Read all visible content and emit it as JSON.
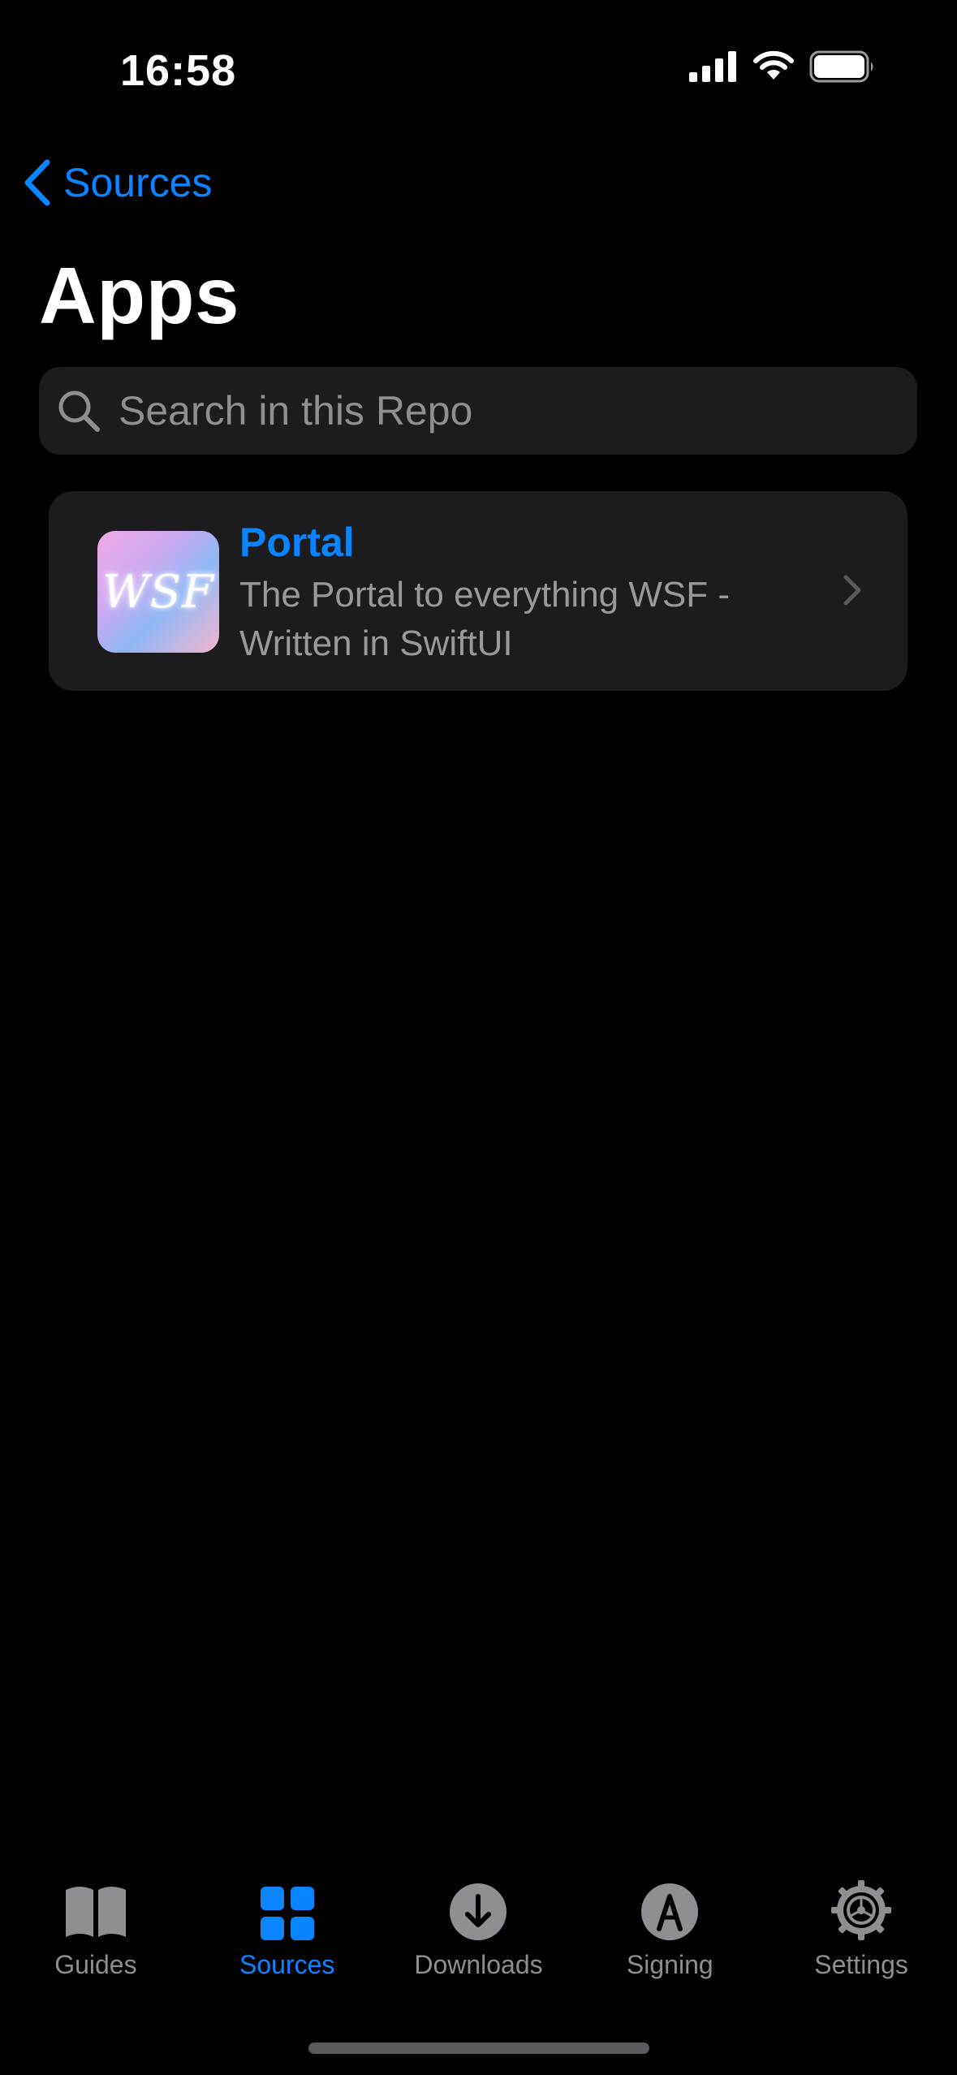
{
  "status_bar": {
    "time": "16:58"
  },
  "nav": {
    "back_label": "Sources",
    "title": "Apps"
  },
  "search": {
    "placeholder": "Search in this Repo",
    "value": ""
  },
  "apps": [
    {
      "icon_text": "WSF",
      "name": "Portal",
      "description": "The Portal to everything WSF - Written in SwiftUI"
    }
  ],
  "tabbar": {
    "active": "Sources",
    "items": [
      {
        "label": "Guides",
        "icon": "book-icon"
      },
      {
        "label": "Sources",
        "icon": "grid-icon"
      },
      {
        "label": "Downloads",
        "icon": "download-icon"
      },
      {
        "label": "Signing",
        "icon": "signing-icon"
      },
      {
        "label": "Settings",
        "icon": "gear-icon"
      }
    ]
  },
  "colors": {
    "accent": "#0a84ff",
    "background": "#000000",
    "card": "#1c1c1e",
    "secondary_text": "#98989d",
    "inactive_tab": "#8e8e93"
  }
}
